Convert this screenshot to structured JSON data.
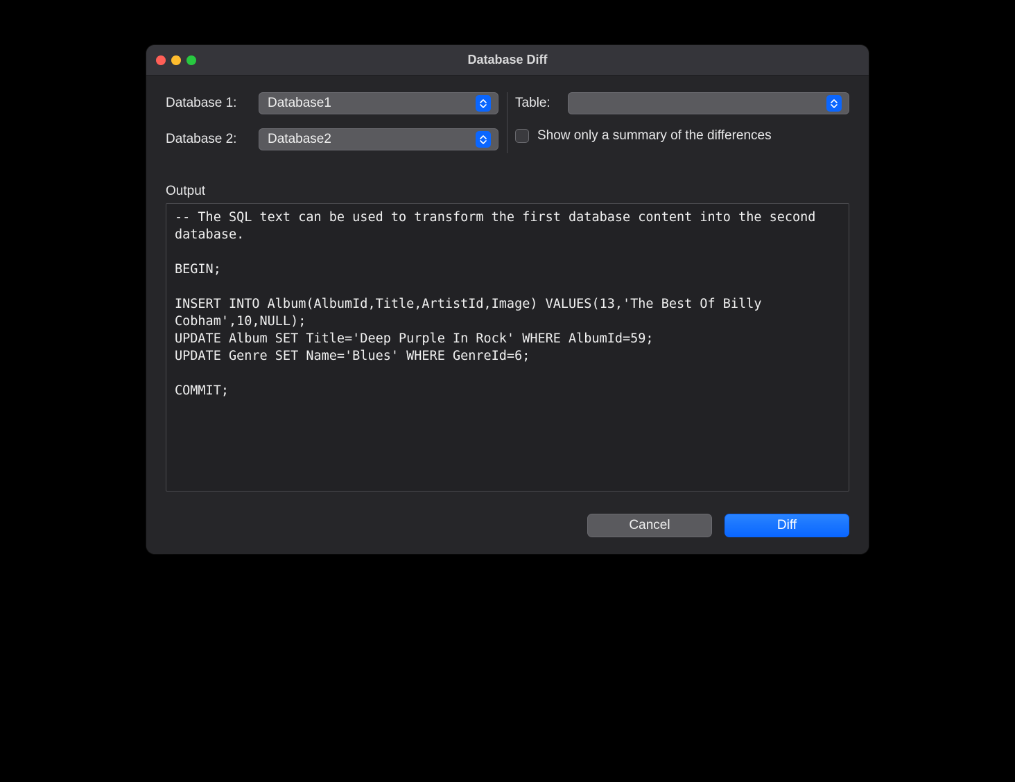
{
  "window": {
    "title": "Database Diff"
  },
  "form": {
    "db1_label": "Database 1:",
    "db1_value": "Database1",
    "db2_label": "Database 2:",
    "db2_value": "Database2",
    "table_label": "Table:",
    "table_value": "",
    "summary_checkbox_label": "Show only a summary of the differences",
    "summary_checked": false
  },
  "output": {
    "label": "Output",
    "text": "-- The SQL text can be used to transform the first database content into the second database.\n\nBEGIN;\n\nINSERT INTO Album(AlbumId,Title,ArtistId,Image) VALUES(13,'The Best Of Billy Cobham',10,NULL);\nUPDATE Album SET Title='Deep Purple In Rock' WHERE AlbumId=59;\nUPDATE Genre SET Name='Blues' WHERE GenreId=6;\n\nCOMMIT;"
  },
  "actions": {
    "cancel": "Cancel",
    "diff": "Diff"
  }
}
